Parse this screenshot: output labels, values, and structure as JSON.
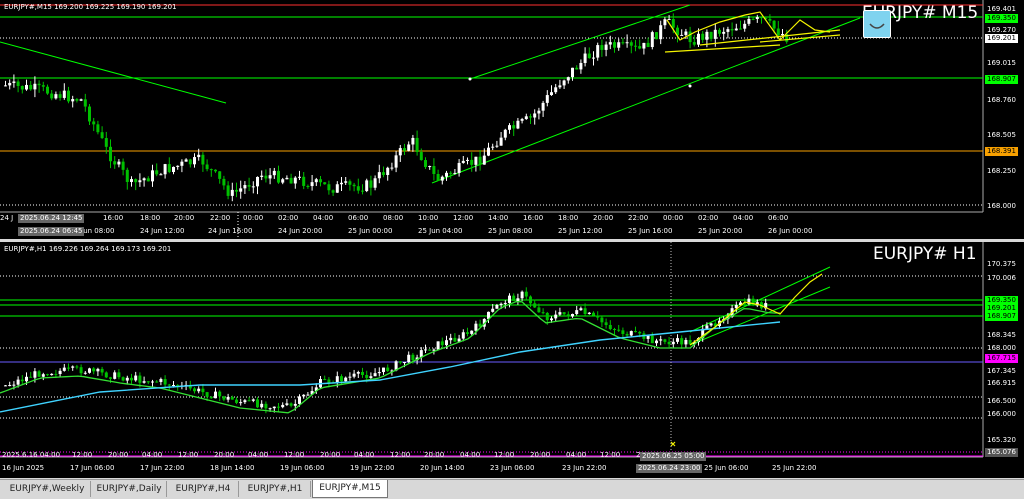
{
  "colors": {
    "bull": "#ffffff",
    "bear": "#00c000",
    "upper_chart_bg": "#000000",
    "lime": "#00ff00",
    "orange": "#f7a000",
    "magenta": "#ff00ff",
    "cyan": "#3fd3ff",
    "yellow": "#f4f400",
    "blue_line": "#6a5cff"
  },
  "top": {
    "header": "EURJPY#,M15  169.200 169.225 169.190 169.201",
    "symbol_label": "EURJPY# M15",
    "icon": "smiley-face-icon",
    "price_axis": [
      "169.401",
      "169.350",
      "169.270",
      "169.201",
      "169.015",
      "168.907",
      "168.760",
      "168.505",
      "168.391",
      "168.250",
      "168.000"
    ],
    "time_axis": [
      "24 J",
      "16:00",
      "18:00",
      "20:00",
      "22:00",
      "00:00",
      "02:00",
      "04:00",
      "06:00",
      "08:00",
      "10:00",
      "12:00",
      "14:00",
      "16:00",
      "18:00",
      "20:00",
      "22:00",
      "00:00",
      "02:00",
      "04:00",
      "06:00"
    ],
    "date_axis": [
      "24 Jun 08:00",
      "24 Jun 12:00",
      "24 Jun 16:00",
      "24 Jun 20:00",
      "25 Jun 00:00",
      "25 Jun 04:00",
      "25 Jun 08:00",
      "25 Jun 12:00",
      "25 Jun 16:00",
      "25 Jun 20:00",
      "26 Jun 00:00"
    ],
    "crosshair_boxes": [
      "2025.06.24 12:45",
      "2025.06.24 06:45"
    ]
  },
  "bottom": {
    "header": "EURJPY#,H1  169.226 169.264 169.173 169.201",
    "symbol_label": "EURJPY# H1",
    "price_axis": [
      "170.375",
      "170.006",
      "169.350",
      "169.201",
      "168.907",
      "168.345",
      "168.000",
      "167.715",
      "167.345",
      "166.915",
      "166.500",
      "166.000",
      "165.320",
      "165.076"
    ],
    "time_axis": [
      "2025.6.16 04:00",
      "12:00",
      "20:00",
      "04:00",
      "12:00",
      "20:00",
      "04:00",
      "12:00",
      "20:00",
      "04:00",
      "12:00",
      "20:00",
      "04:00",
      "12:00",
      "20:00",
      "04:00",
      "12:00",
      "20:00"
    ],
    "date_axis": [
      "16 Jun 2025",
      "17 Jun 06:00",
      "17 Jun 22:00",
      "18 Jun 14:00",
      "19 Jun 06:00",
      "19 Jun 22:00",
      "20 Jun 14:00",
      "23 Jun 06:00",
      "23 Jun 22:00",
      "25 Jun 06:00",
      "25 Jun 22:00"
    ],
    "crosshair_boxes": [
      "2025.06.25 05:00",
      "2025.06.24 23:00"
    ]
  },
  "tabs": [
    "EURJPY#,Weekly",
    "EURJPY#,Daily",
    "EURJPY#,H4",
    "EURJPY#,H1",
    "EURJPY#,M15"
  ],
  "active_tab": "EURJPY#,M15"
}
